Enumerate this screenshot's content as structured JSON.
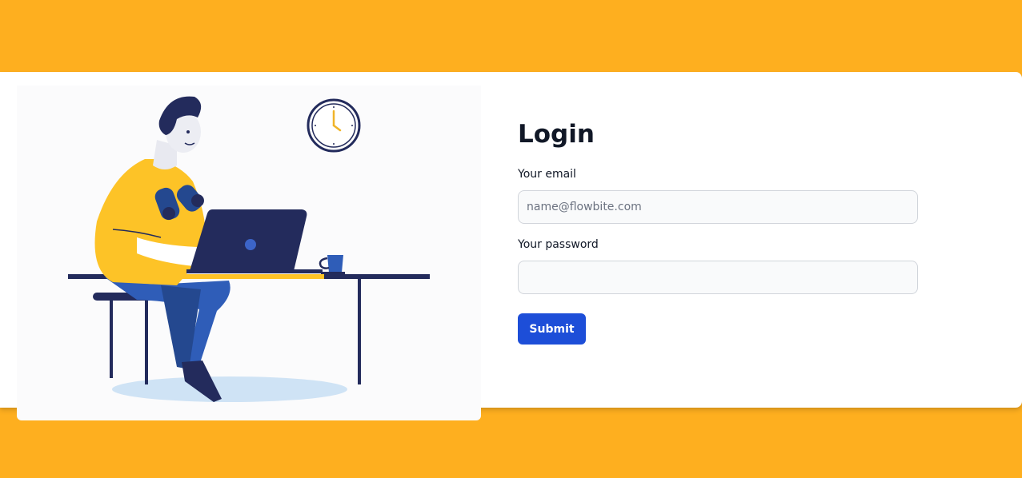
{
  "colors": {
    "page_background": "#FEAF1F",
    "card_background": "#FFFFFF",
    "button_background": "#1D4ED8",
    "illustration_primary": "#232B5C",
    "illustration_accent": "#FDC327",
    "illustration_blue": "#2F5DB8"
  },
  "illustration": {
    "icon": "person-at-laptop-illustration"
  },
  "form": {
    "title": "Login",
    "email": {
      "label": "Your email",
      "placeholder": "name@flowbite.com",
      "value": ""
    },
    "password": {
      "label": "Your password",
      "placeholder": "",
      "value": ""
    },
    "submit_label": "Submit"
  }
}
